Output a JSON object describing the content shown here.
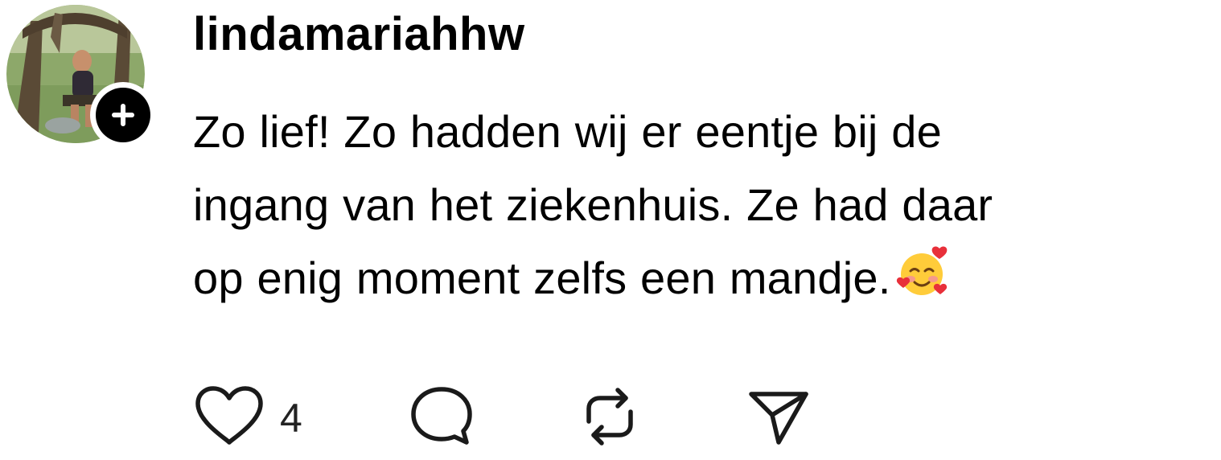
{
  "post": {
    "username": "lindamariahhw",
    "comment_lines": [
      "Zo lief! Zo hadden wij er eentje bij de",
      "ingang van het ziekenhuis. Ze had daar",
      "op enig moment zelfs een mandje."
    ],
    "comment_emoji": "smiling-face-with-hearts"
  },
  "actions": {
    "like_count": "4",
    "icons": [
      "heart-icon",
      "comment-icon",
      "repost-icon",
      "share-icon"
    ]
  },
  "colors": {
    "text": "#000000",
    "background": "#ffffff",
    "badge": "#000000"
  }
}
